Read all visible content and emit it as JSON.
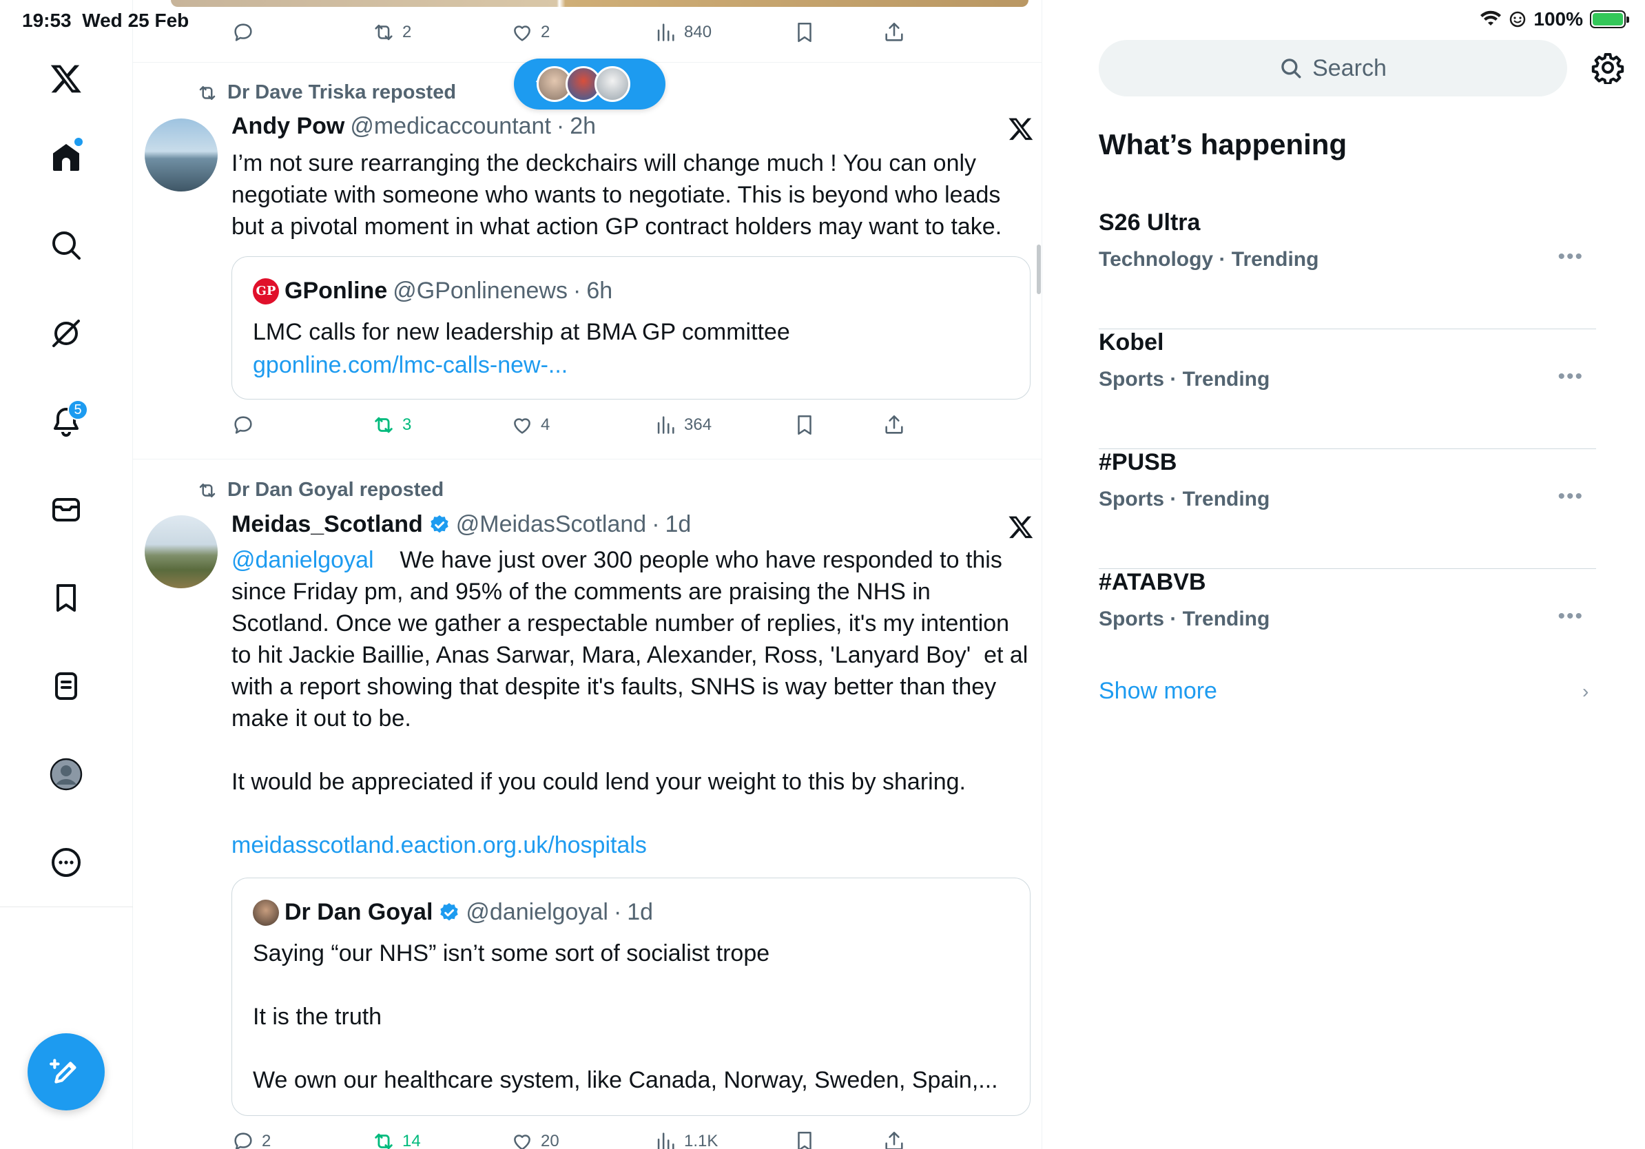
{
  "status": {
    "time": "19:53",
    "date": "Wed 25 Feb",
    "battery": "100%"
  },
  "nav": {
    "notification_count": "5"
  },
  "top_tweet_actions": {
    "reposts": "2",
    "likes": "2",
    "views": "840"
  },
  "tweet1": {
    "reposted_by": "Dr Dave Triska reposted",
    "name": "Andy Pow",
    "handle": "@medicaccountant",
    "time": "2h",
    "text": "I’m not sure rearranging the deckchairs will change much ! You can only negotiate with someone who wants to negotiate. This is beyond who leads but a pivotal moment in what action GP contract holders may want to take.",
    "quote": {
      "avatar_text": "GP",
      "name": "GPonline",
      "handle": "@GPonlinenews",
      "time": "6h",
      "text": "LMC calls for new leadership at BMA GP committee",
      "link": "gponline.com/lmc-calls-new-..."
    },
    "reposts": "3",
    "likes": "4",
    "views": "364"
  },
  "tweet2": {
    "reposted_by": "Dr Dan Goyal reposted",
    "name": "Meidas_Scotland",
    "handle": "@MeidasScotland",
    "time": "1d",
    "mention": "@danielgoyal",
    "text_after_mention": "We have just over 300 people who have responded to this since Friday pm, and 95% of the comments are praising the NHS in Scotland. Once we gather a respectable number of replies, it's my intention to hit Jackie Baillie, Anas Sarwar, Mara, Alexander, Ross, 'Lanyard Boy'  et al with a report showing that despite it's faults, SNHS is way better than they make it out to be.",
    "text_para2": "It would be appreciated if you could lend your weight to this by sharing.",
    "link": "meidasscotland.eaction.org.uk/hospitals",
    "quote": {
      "name": "Dr Dan Goyal",
      "handle": "@danielgoyal",
      "time": "1d",
      "line1": "Saying “our NHS” isn’t some sort of socialist trope",
      "line2": "It is the truth",
      "line3": "We own our healthcare system, like Canada, Norway, Sweden, Spain,..."
    },
    "replies": "2",
    "reposts": "14",
    "likes": "20",
    "views": "1.1K"
  },
  "sidebar": {
    "search_placeholder": "Search",
    "title": "What’s happening",
    "trends": [
      {
        "name": "S26 Ultra",
        "meta": "Technology · Trending"
      },
      {
        "name": "Kobel",
        "meta": "Sports · Trending"
      },
      {
        "name": "#PUSB",
        "meta": "Sports · Trending"
      },
      {
        "name": "#ATABVB",
        "meta": "Sports · Trending"
      }
    ],
    "show_more": "Show more"
  },
  "colors": {
    "accent": "#1d9bf0",
    "repost_active": "#00ba7c",
    "muted": "#536471"
  }
}
